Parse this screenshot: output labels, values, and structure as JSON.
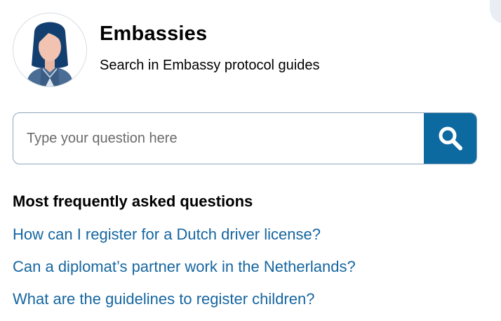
{
  "header": {
    "title": "Embassies",
    "subtitle": "Search in Embassy protocol guides",
    "avatar_icon": "woman-avatar-icon"
  },
  "search": {
    "placeholder": "Type your question here",
    "value": "",
    "button_icon": "search-icon"
  },
  "faq": {
    "heading": "Most frequently asked questions",
    "items": [
      {
        "label": "How can I register for a Dutch driver license?"
      },
      {
        "label": "Can a diplomat’s partner work in the Netherlands?"
      },
      {
        "label": "What are the guidelines to register children?"
      }
    ]
  },
  "colors": {
    "accent": "#0d6aa0",
    "link": "#1666a0",
    "border": "#8fa6bb"
  }
}
